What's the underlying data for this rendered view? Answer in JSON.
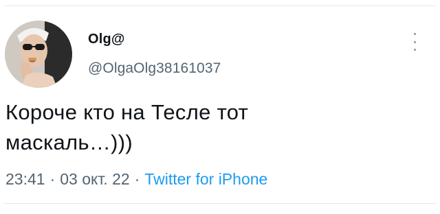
{
  "tweet": {
    "author": {
      "display_name": "Olg@",
      "handle": "@OlgaOlg38161037",
      "avatar_icon": "profile-photo"
    },
    "text_line1": "Короче кто на Тесле тот",
    "text_line2": "маскаль…)))",
    "meta": {
      "time": "23:41",
      "date": "03 окт. 22",
      "separator": "·",
      "source": "Twitter for iPhone"
    },
    "more_icon": "more-vertical-icon"
  },
  "colors": {
    "text": "#0f1419",
    "secondary": "#536471",
    "link": "#1d9bf0",
    "divider": "#e6e6e6"
  }
}
